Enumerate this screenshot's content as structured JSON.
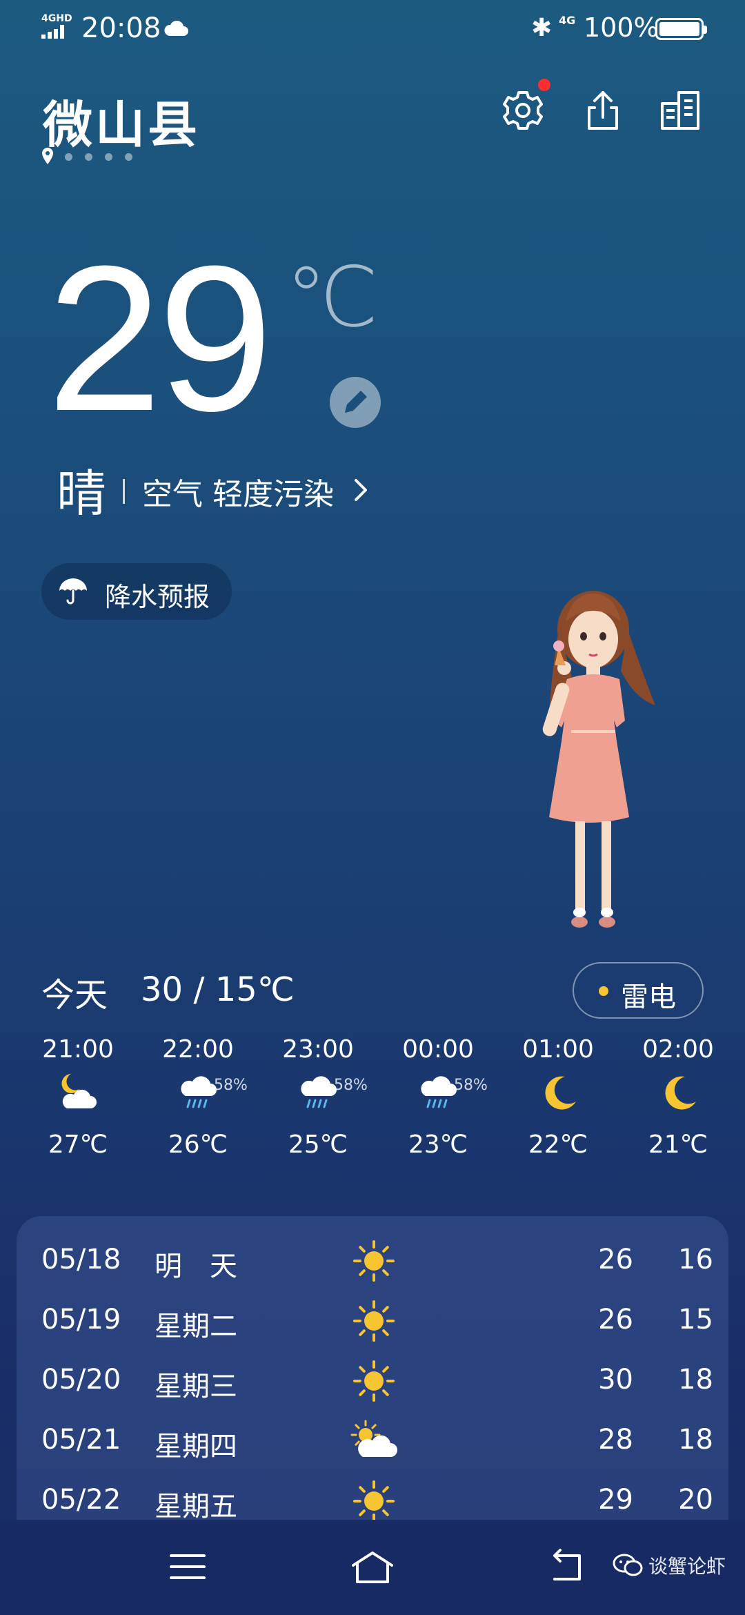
{
  "status_bar": {
    "network": "4GHD",
    "time": "20:08",
    "mobile_data": "4G",
    "battery_pct": "100%",
    "battery_level": 1.0,
    "icons": [
      "signal-icon",
      "cloud-icon",
      "bluetooth-icon",
      "battery-icon"
    ]
  },
  "header": {
    "city": "微山县",
    "page_count": 5,
    "current_page": 0,
    "has_notification": true
  },
  "current": {
    "temperature": "29",
    "unit": "℃",
    "condition": "晴",
    "air_quality": "空气 轻度污染"
  },
  "precip_button": {
    "label": "降水预报",
    "icon": "umbrella-icon"
  },
  "today": {
    "label": "今天",
    "range": "30 / 15℃",
    "alert": "雷电",
    "alert_color": "#f6c531"
  },
  "hourly": [
    {
      "time": "21:00",
      "icon": "partly-cloudy-night-icon",
      "pop": "",
      "temp": "27℃"
    },
    {
      "time": "22:00",
      "icon": "rain-icon",
      "pop": "58%",
      "temp": "26℃"
    },
    {
      "time": "23:00",
      "icon": "rain-icon",
      "pop": "58%",
      "temp": "25℃"
    },
    {
      "time": "00:00",
      "icon": "rain-icon",
      "pop": "58%",
      "temp": "23℃"
    },
    {
      "time": "01:00",
      "icon": "moon-icon",
      "pop": "",
      "temp": "22℃"
    },
    {
      "time": "02:00",
      "icon": "moon-icon",
      "pop": "",
      "temp": "21℃"
    }
  ],
  "daily": [
    {
      "date": "05/18",
      "day": "明　天",
      "icon": "sun-icon",
      "high": "26",
      "low": "16"
    },
    {
      "date": "05/19",
      "day": "星期二",
      "icon": "sun-icon",
      "high": "26",
      "low": "15"
    },
    {
      "date": "05/20",
      "day": "星期三",
      "icon": "sun-icon",
      "high": "30",
      "low": "18"
    },
    {
      "date": "05/21",
      "day": "星期四",
      "icon": "partly-cloudy-day-icon",
      "high": "28",
      "low": "18"
    },
    {
      "date": "05/22",
      "day": "星期五",
      "icon": "sun-icon",
      "high": "29",
      "low": "20"
    }
  ],
  "watermark": {
    "text": "谈蟹论虾"
  },
  "colors": {
    "background_top": "#1c5a80",
    "background_bottom": "#172a63",
    "sun": "#f6c531",
    "notification": "#ff2d2d"
  }
}
